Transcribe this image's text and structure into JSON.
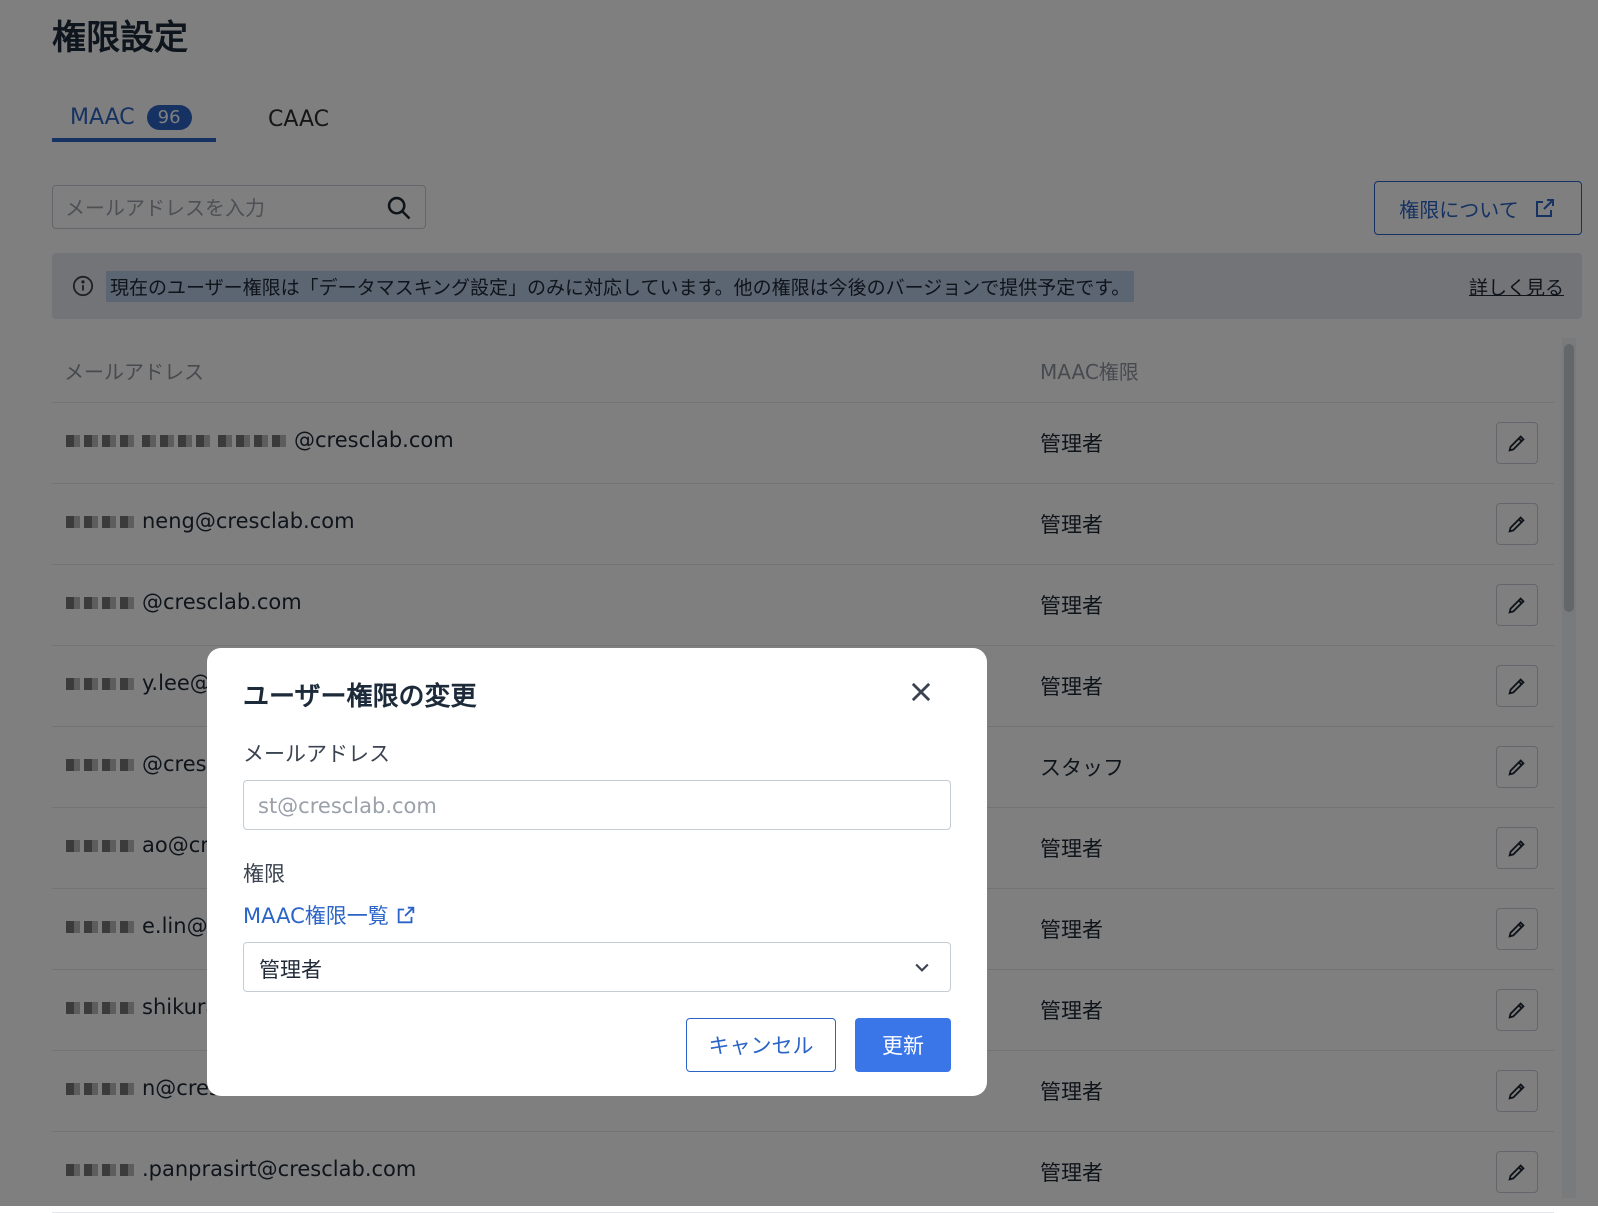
{
  "page": {
    "title": "権限設定"
  },
  "tabs": [
    {
      "label": "MAAC",
      "badge": "96",
      "active": true
    },
    {
      "label": "CAAC",
      "active": false
    }
  ],
  "search": {
    "placeholder": "メールアドレスを入力"
  },
  "about_button": {
    "label": "権限について"
  },
  "banner": {
    "message": "現在のユーザー権限は「データマスキング設定」のみに対応しています。他の権限は今後のバージョンで提供予定です。",
    "link": "詳しく見る"
  },
  "table": {
    "headers": {
      "email": "メールアドレス",
      "role": "MAAC権限"
    },
    "rows": [
      {
        "email": "@cresclab.com",
        "role": "管理者"
      },
      {
        "email": "neng@cresclab.com",
        "role": "管理者"
      },
      {
        "email": "@cresclab.com",
        "role": "管理者"
      },
      {
        "email": "y.lee@c",
        "role": "管理者"
      },
      {
        "email": "@cresc",
        "role": "スタッフ"
      },
      {
        "email": "ao@cres",
        "role": "管理者"
      },
      {
        "email": "e.lin@cr",
        "role": "管理者"
      },
      {
        "email": "shikura",
        "role": "管理者"
      },
      {
        "email": "n@cresclab.com",
        "role": "管理者"
      },
      {
        "email": ".panprasirt@cresclab.com",
        "role": "管理者"
      }
    ]
  },
  "modal": {
    "title": "ユーザー権限の変更",
    "email_label": "メールアドレス",
    "email_value": "st@cresclab.com",
    "permission_label": "権限",
    "permission_link": "MAAC権限一覧",
    "permission_value": "管理者",
    "cancel_label": "キャンセル",
    "update_label": "更新"
  },
  "colors": {
    "accent": "#2a64c7",
    "primary_button": "#3b76e8"
  },
  "icons": [
    "search-icon",
    "external-link-icon",
    "info-icon",
    "pencil-icon",
    "close-icon",
    "chevron-down-icon"
  ]
}
